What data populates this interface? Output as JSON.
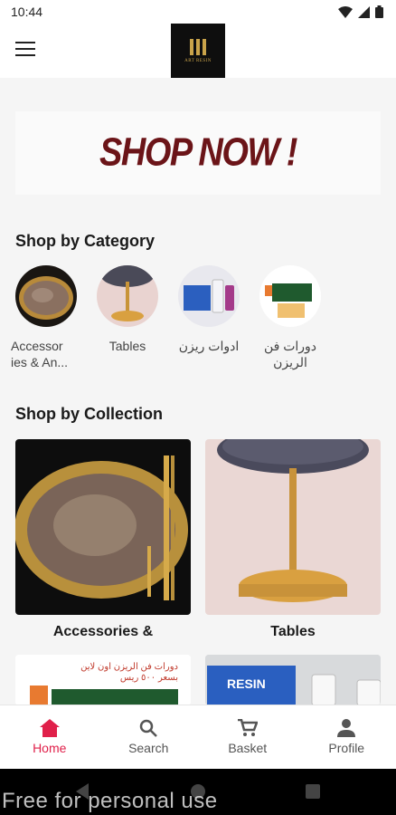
{
  "status_bar": {
    "time": "10:44"
  },
  "app_bar": {
    "menu_icon": "hamburger-menu-icon",
    "logo_text": "ART RESIN"
  },
  "banner": {
    "text": "SHOP NOW !"
  },
  "categories": {
    "title": "Shop by Category",
    "items": [
      {
        "label": "Accessor ies & An...",
        "image": "gold-tray"
      },
      {
        "label": "Tables",
        "image": "resin-table"
      },
      {
        "label": "ادوات ريزن",
        "image": "resin-bottles"
      },
      {
        "label": "دورات فن الريزن",
        "image": "course-poster"
      }
    ]
  },
  "collections": {
    "title": "Shop by Collection",
    "items": [
      {
        "label": "Accessories &",
        "image": "gold-tray"
      },
      {
        "label": "Tables",
        "image": "resin-table"
      },
      {
        "label": "",
        "image": "course-poster",
        "poster_text": "دورات فن الريزن اون لاين بسعر ٥٠٠ ريس"
      },
      {
        "label": "",
        "image": "resin-box",
        "box_text": "RESIN"
      }
    ]
  },
  "bottom_nav": {
    "items": [
      {
        "label": "Home",
        "icon": "home-icon",
        "active": true
      },
      {
        "label": "Search",
        "icon": "search-icon",
        "active": false
      },
      {
        "label": "Basket",
        "icon": "cart-icon",
        "active": false
      },
      {
        "label": "Profile",
        "icon": "person-icon",
        "active": false
      }
    ]
  },
  "watermark": "Free for personal use",
  "colors": {
    "accent": "#e0204a",
    "banner_text": "#6b1418",
    "gold": "#c9a34a"
  }
}
